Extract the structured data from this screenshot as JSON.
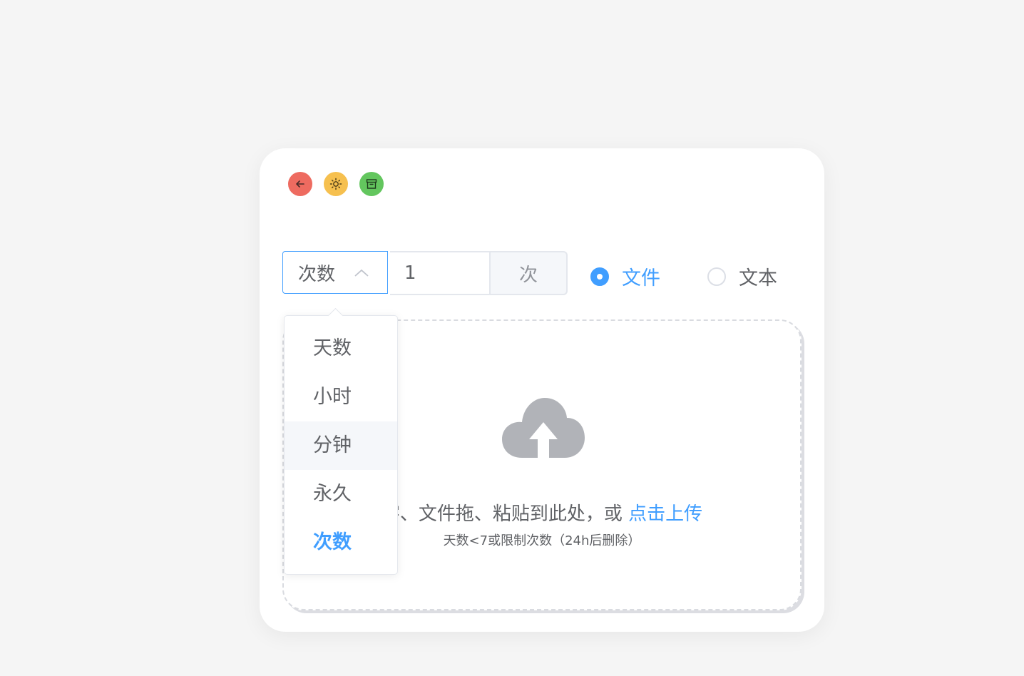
{
  "window_buttons": [
    {
      "icon": "back-arrow-icon",
      "color": "#ee6b60"
    },
    {
      "icon": "sun-icon",
      "color": "#f6c04f"
    },
    {
      "icon": "archive-box-icon",
      "color": "#63c65e"
    }
  ],
  "expiry": {
    "select_value": "次数",
    "amount": "1",
    "unit": "次",
    "options": [
      "天数",
      "小时",
      "分钟",
      "永久",
      "次数"
    ],
    "hovered_option": "分钟",
    "selected_option": "次数"
  },
  "mode": {
    "file_label": "文件",
    "text_label": "文本",
    "selected": "文件"
  },
  "upload": {
    "prompt_visible": "字、文件拖、粘贴到此处，或",
    "link": "点击上传",
    "tip": "天数<7或限制次数（24h后删除）"
  },
  "colors": {
    "accent": "#409eff",
    "background": "#f5f5f5",
    "icon_gray": "#b1b3b8"
  }
}
